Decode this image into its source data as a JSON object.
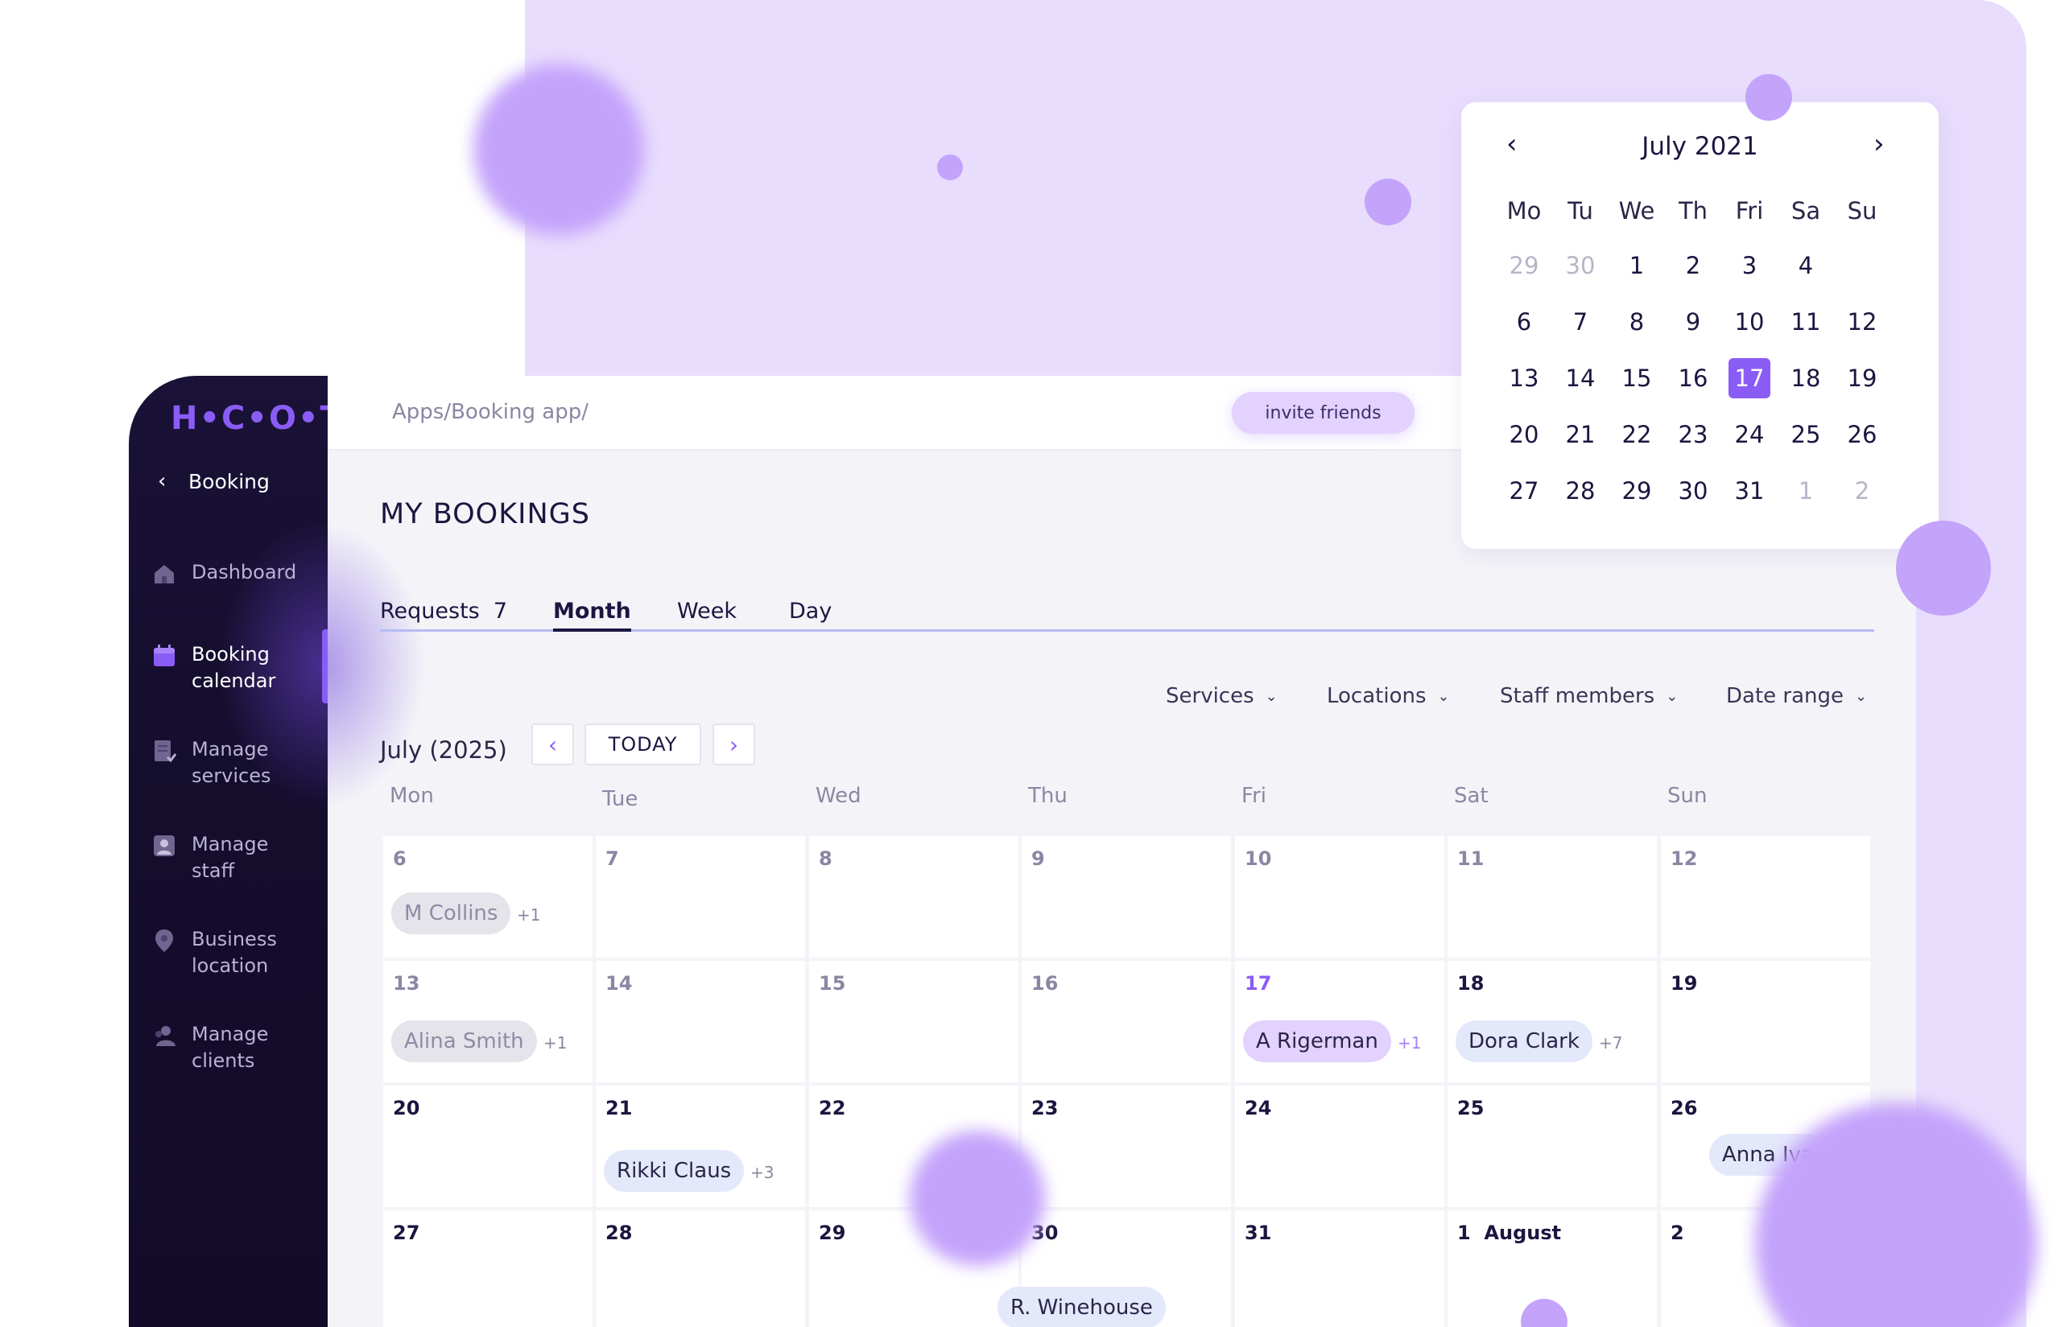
{
  "brand": {
    "logo_text": "H•C•O•T"
  },
  "breadcrumb": "Apps/Booking app/",
  "invite_label": "invite friends",
  "sidebar": {
    "back_label": "Booking",
    "items": [
      {
        "label": "Dashboard",
        "icon": "home-icon"
      },
      {
        "label": "Booking\ncalendar",
        "icon": "calendar-icon",
        "active": true
      },
      {
        "label": "Manage\nservices",
        "icon": "checklist-icon"
      },
      {
        "label": "Manage\nstaff",
        "icon": "staff-icon"
      },
      {
        "label": "Business\nlocation",
        "icon": "location-pin-icon"
      },
      {
        "label": "Manage\nclients",
        "icon": "clients-icon"
      }
    ]
  },
  "page_title": "MY BOOKINGS",
  "tabs": [
    {
      "label": "Requests  7"
    },
    {
      "label": "Month",
      "active": true
    },
    {
      "label": "Week"
    },
    {
      "label": "Day"
    }
  ],
  "filters": [
    "Services",
    "Locations",
    "Staff members",
    "Date range"
  ],
  "calendar": {
    "month_label": "July (2025)",
    "today_label": "TODAY",
    "weekdays": [
      "Mon",
      "Tue",
      "Wed",
      "Thu",
      "Fri",
      "Sat",
      "Sun"
    ],
    "weeks": [
      [
        {
          "day": "6",
          "chip": "M Collins",
          "more": "+1",
          "style": "grey"
        },
        {
          "day": "7"
        },
        {
          "day": "8"
        },
        {
          "day": "9"
        },
        {
          "day": "10"
        },
        {
          "day": "11"
        },
        {
          "day": "12"
        }
      ],
      [
        {
          "day": "13",
          "chip": "Alina Smith",
          "more": "+1",
          "style": "grey"
        },
        {
          "day": "14"
        },
        {
          "day": "15"
        },
        {
          "day": "16"
        },
        {
          "day": "17",
          "chip": "A Rigerman",
          "more": "+1",
          "style": "purple",
          "today": true
        },
        {
          "day": "18",
          "chip": "Dora Clark",
          "more": "+7",
          "style": "blue",
          "dark": true
        },
        {
          "day": "19",
          "dark": true
        }
      ],
      [
        {
          "day": "20",
          "dark": true
        },
        {
          "day": "21",
          "chip": "Rikki Claus",
          "more": "+3",
          "style": "blue",
          "dark": true
        },
        {
          "day": "22",
          "dark": true
        },
        {
          "day": "23",
          "dark": true
        },
        {
          "day": "24",
          "dark": true
        },
        {
          "day": "25",
          "dark": true
        },
        {
          "day": "26",
          "chip": "Anna Iva",
          "style": "blue",
          "dark": true
        }
      ],
      [
        {
          "day": "27",
          "dark": true
        },
        {
          "day": "28",
          "dark": true
        },
        {
          "day": "29",
          "dark": true
        },
        {
          "day": "30",
          "chip": "R. Winehouse",
          "style": "blue",
          "dark": true
        },
        {
          "day": "31",
          "dark": true
        },
        {
          "day": "1  August",
          "dark": true
        },
        {
          "day": "2",
          "dark": true
        }
      ]
    ]
  },
  "datepicker": {
    "title": "July 2021",
    "prev_arrow": "‹",
    "next_arrow": "›",
    "headers": [
      "Mo",
      "Tu",
      "We",
      "Th",
      "Fri",
      "Sa",
      "Su"
    ],
    "rows": [
      [
        {
          "d": "29",
          "muted": true
        },
        {
          "d": "30",
          "muted": true
        },
        {
          "d": "1"
        },
        {
          "d": "2"
        },
        {
          "d": "3"
        },
        {
          "d": "4"
        },
        {
          "d": ""
        }
      ],
      [
        {
          "d": "6"
        },
        {
          "d": "7"
        },
        {
          "d": "8"
        },
        {
          "d": "9"
        },
        {
          "d": "10"
        },
        {
          "d": "11"
        },
        {
          "d": "12"
        }
      ],
      [
        {
          "d": "13"
        },
        {
          "d": "14"
        },
        {
          "d": "15"
        },
        {
          "d": "16"
        },
        {
          "d": "17",
          "selected": true
        },
        {
          "d": "18"
        },
        {
          "d": "19"
        }
      ],
      [
        {
          "d": "20"
        },
        {
          "d": "21"
        },
        {
          "d": "22"
        },
        {
          "d": "23"
        },
        {
          "d": "24"
        },
        {
          "d": "25"
        },
        {
          "d": "26"
        }
      ],
      [
        {
          "d": "27"
        },
        {
          "d": "28"
        },
        {
          "d": "29"
        },
        {
          "d": "30"
        },
        {
          "d": "31"
        },
        {
          "d": "1",
          "muted": true
        },
        {
          "d": "2",
          "muted": true
        }
      ]
    ]
  },
  "colors": {
    "accent": "#8a5cf6",
    "sidebar": "#140d2c",
    "bg_panel": "#e8ddfd",
    "blob": "#c4a3fb"
  }
}
